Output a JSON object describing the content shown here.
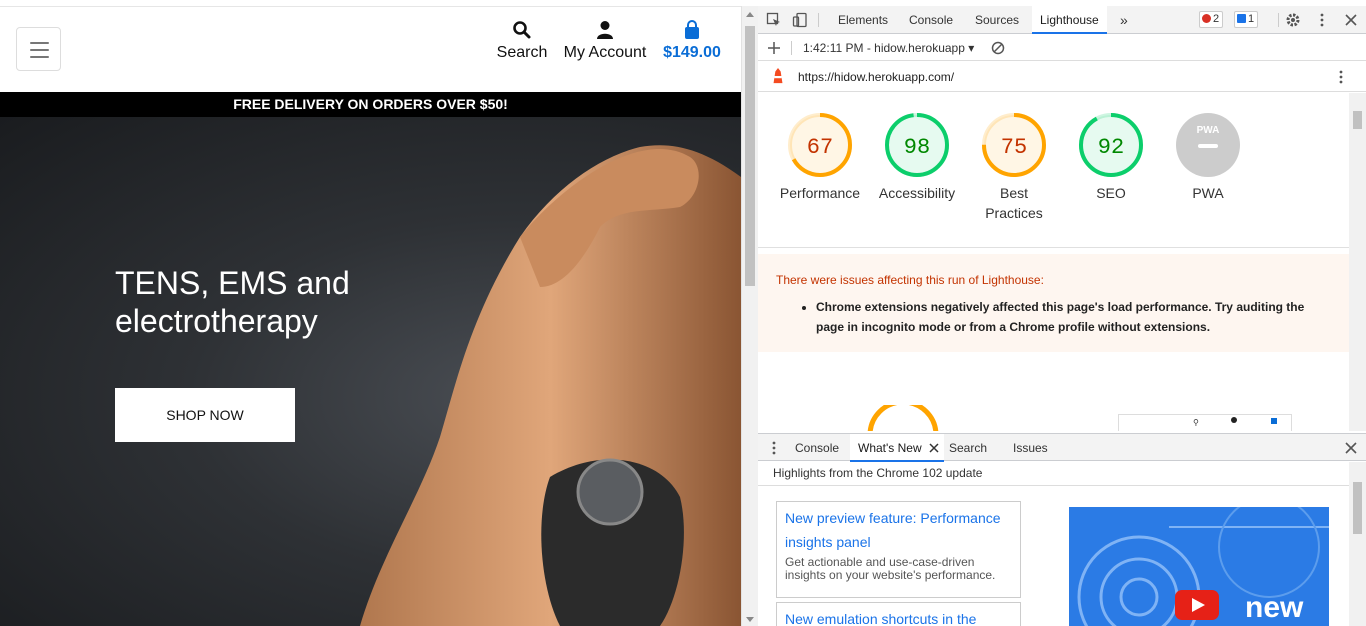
{
  "site": {
    "nav": {
      "search_label": "Search",
      "account_label": "My Account",
      "cart_total": "$149.00"
    },
    "promo_text": "FREE DELIVERY ON ORDERS OVER $50!",
    "hero": {
      "title": "TENS, EMS and electrotherapy",
      "button_label": "SHOP NOW"
    }
  },
  "devtools": {
    "tabs": [
      "Elements",
      "Console",
      "Sources",
      "Lighthouse"
    ],
    "active_tab": "Lighthouse",
    "more_tabs": "»",
    "error_count": "2",
    "message_count": "1",
    "report_selector": "1:42:11 PM - hidow.herokuapp",
    "report_url": "https://hidow.herokuapp.com/",
    "scores": [
      {
        "label": "Performance",
        "value": "67",
        "color": "#ffa400",
        "textcolor": "#c33300"
      },
      {
        "label": "Accessibility",
        "value": "98",
        "color": "#0cce6b",
        "textcolor": "#008800"
      },
      {
        "label": "Best Practices",
        "value": "75",
        "color": "#ffa400",
        "textcolor": "#c33300"
      },
      {
        "label": "SEO",
        "value": "92",
        "color": "#0cce6b",
        "textcolor": "#008800"
      },
      {
        "label": "PWA",
        "value": "PWA",
        "color": "#cccccc",
        "textcolor": "#ffffff"
      }
    ],
    "warning": {
      "title": "There were issues affecting this run of Lighthouse:",
      "item": "Chrome extensions negatively affected this page's load performance. Try auditing the page in incognito mode or from a Chrome profile without extensions."
    },
    "drawer": {
      "tabs": [
        "Console",
        "What's New",
        "Search",
        "Issues"
      ],
      "active_tab": "What's New",
      "heading": "Highlights from the Chrome 102 update",
      "cards": [
        {
          "title": "New preview feature: Performance insights panel",
          "desc": "Get actionable and use-case-driven insights on your website's performance."
        },
        {
          "title": "New emulation shortcuts in the",
          "desc": ""
        }
      ],
      "video_word": "new"
    }
  },
  "colors": {
    "accent": "#1a73e8",
    "cart": "#0a6dd6",
    "pass": "#0cce6b",
    "average": "#ffa400"
  }
}
